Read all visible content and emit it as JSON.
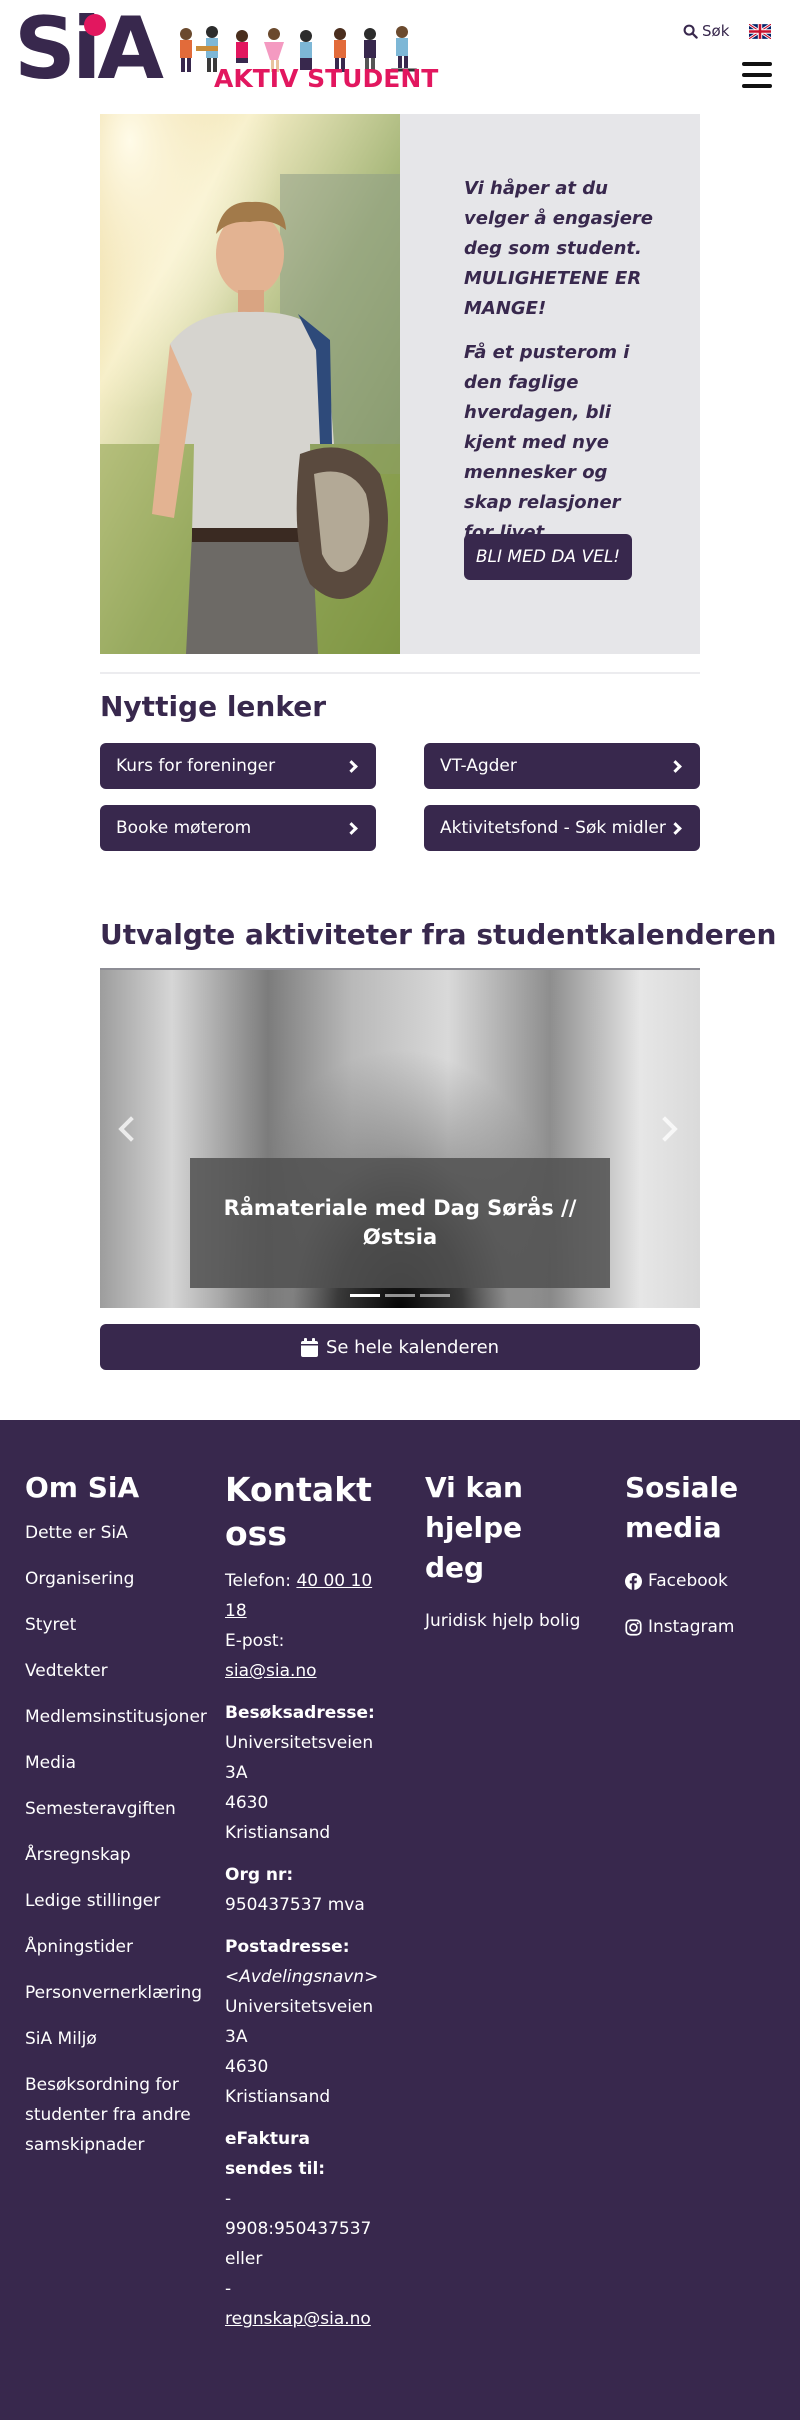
{
  "header": {
    "logo_text": "SiA",
    "banner_text": "AKTIV STUDENT",
    "search_label": "Søk",
    "language_flag_icon": "uk-flag-icon",
    "menu_icon": "hamburger-menu-icon"
  },
  "hero": {
    "paragraph_1": "Vi håper at du velger å engasjere deg som student. MULIGHETENE ER MANGE!",
    "paragraph_2": "Få et pusterom i den faglige hverdagen, bli kjent med nye mennesker og skap relasjoner for livet.",
    "button_label": "BLI MED DA VEL!"
  },
  "useful_links": {
    "heading": "Nyttige lenker",
    "items": [
      {
        "label": "Kurs for foreninger"
      },
      {
        "label": "VT-Agder"
      },
      {
        "label": "Booke møterom"
      },
      {
        "label": "Aktivitetsfond - Søk midler"
      }
    ]
  },
  "calendar": {
    "heading": "Utvalgte aktiviteter fra studentkalenderen",
    "slide_caption": "Råmateriale med Dag Sørås // Østsia",
    "slide_count": 3,
    "active_slide": 1,
    "see_all_label": "Se hele kalenderen"
  },
  "footer": {
    "about": {
      "heading": "Om SiA",
      "links": [
        "Dette er SiA",
        "Organisering",
        "Styret",
        "Vedtekter",
        "Medlemsinstitusjoner",
        "Media",
        "Semesteravgiften",
        "Årsregnskap",
        "Ledige stillinger",
        "Åpningstider",
        "Personvernerklæring",
        "SiA Miljø",
        "Besøksordning for studenter fra andre samskipnader"
      ]
    },
    "contact": {
      "heading": "Kontakt oss",
      "phone_label": "Telefon:",
      "phone": "40 00 10 18",
      "email_label": "E-post:",
      "email": "sia@sia.no",
      "visit_label": "Besøksadresse:",
      "visit_street": "Universitetsveien 3A",
      "visit_city": "4630 Kristiansand",
      "org_label": "Org nr:",
      "org_value": "950437537 mva",
      "post_label": "Postadresse:",
      "post_dept": "<Avdelingsnavn>",
      "post_street": "Universitetsveien 3A",
      "post_city": "4630 Kristiansand",
      "invoice_label": "eFaktura sendes til:",
      "invoice_line1": "- 9908:950437537 eller",
      "invoice_line2": "- ",
      "invoice_email": "regnskap@sia.no"
    },
    "help": {
      "heading": "Vi kan hjelpe deg",
      "links": [
        "Juridisk hjelp bolig"
      ]
    },
    "social": {
      "heading": "Sosiale media",
      "links": [
        {
          "label": "Facebook",
          "icon": "facebook-icon"
        },
        {
          "label": "Instagram",
          "icon": "instagram-icon"
        }
      ]
    }
  },
  "colors": {
    "brand_purple": "#38284d",
    "brand_pink": "#e2175f",
    "hero_panel": "#e6e6e9"
  }
}
